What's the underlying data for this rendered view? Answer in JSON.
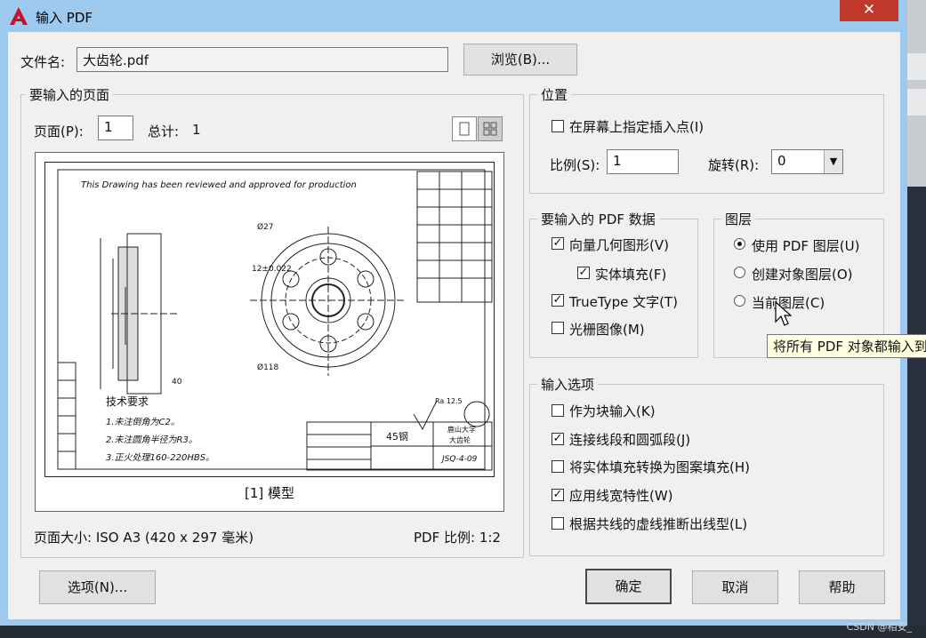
{
  "window": {
    "title": "输入 PDF",
    "close_glyph": "✕"
  },
  "file": {
    "label": "文件名:",
    "value": "大齿轮.pdf",
    "browse_button": "浏览(B)..."
  },
  "pages": {
    "group_title": "要输入的页面",
    "page_label": "页面(P):",
    "page_value": "1",
    "total_label": "总计:",
    "total_value": "1",
    "preview_caption": "[1] 模型",
    "page_size": "页面大小: ISO A3 (420 x 297 毫米)",
    "pdf_scale": "PDF 比例: 1:2",
    "drawing_text": {
      "approval": "This Drawing has been reviewed and approved for production",
      "tech_title": "技术要求",
      "req1": "1.未注倒角为C2。",
      "req2": "2.未注圆角半径为R3。",
      "req3": "3.正火处理160-220HBS。",
      "material": "45钢",
      "dim_27": "Ø27",
      "dim_118": "Ø118",
      "dim_12": "12±0.022",
      "dim_40": "40",
      "roughness": "Ra 12.5",
      "drawing_no": "JSQ-4-09",
      "company": "鹿山大学",
      "part": "大齿轮"
    }
  },
  "position": {
    "group_title": "位置",
    "specify_on_screen": "在屏幕上指定插入点(I)",
    "specify_checked": false,
    "scale_label": "比例(S):",
    "scale_value": "1",
    "rotation_label": "旋转(R):",
    "rotation_value": "0"
  },
  "pdf_data": {
    "group_title": "要输入的 PDF 数据",
    "vector_geometry": "向量几何图形(V)",
    "vector_checked": true,
    "solid_fill": "实体填充(F)",
    "solid_checked": true,
    "truetype_text": "TrueType 文字(T)",
    "truetype_checked": true,
    "raster_images": "光栅图像(M)",
    "raster_checked": false
  },
  "layers": {
    "group_title": "图层",
    "use_pdf_layers": "使用 PDF 图层(U)",
    "create_object_layers": "创建对象图层(O)",
    "current_layer": "当前图层(C)",
    "selected": "use_pdf_layers",
    "tooltip": "将所有 PDF 对象都输入到"
  },
  "import_options": {
    "group_title": "输入选项",
    "as_block": "作为块输入(K)",
    "as_block_checked": false,
    "join_segments": "连接线段和圆弧段(J)",
    "join_checked": true,
    "convert_fills": "将实体填充转换为图案填充(H)",
    "convert_checked": false,
    "apply_lineweight": "应用线宽特性(W)",
    "lineweight_checked": true,
    "infer_linetypes": "根据共线的虚线推断出线型(L)",
    "infer_checked": false
  },
  "buttons": {
    "options": "选项(N)...",
    "ok": "确定",
    "cancel": "取消",
    "help": "帮助"
  },
  "watermark": "CSDN @相安_",
  "colors": {
    "titlebar": "#9ec9ee",
    "close": "#c0392b",
    "app_icon": "#c8102e"
  }
}
